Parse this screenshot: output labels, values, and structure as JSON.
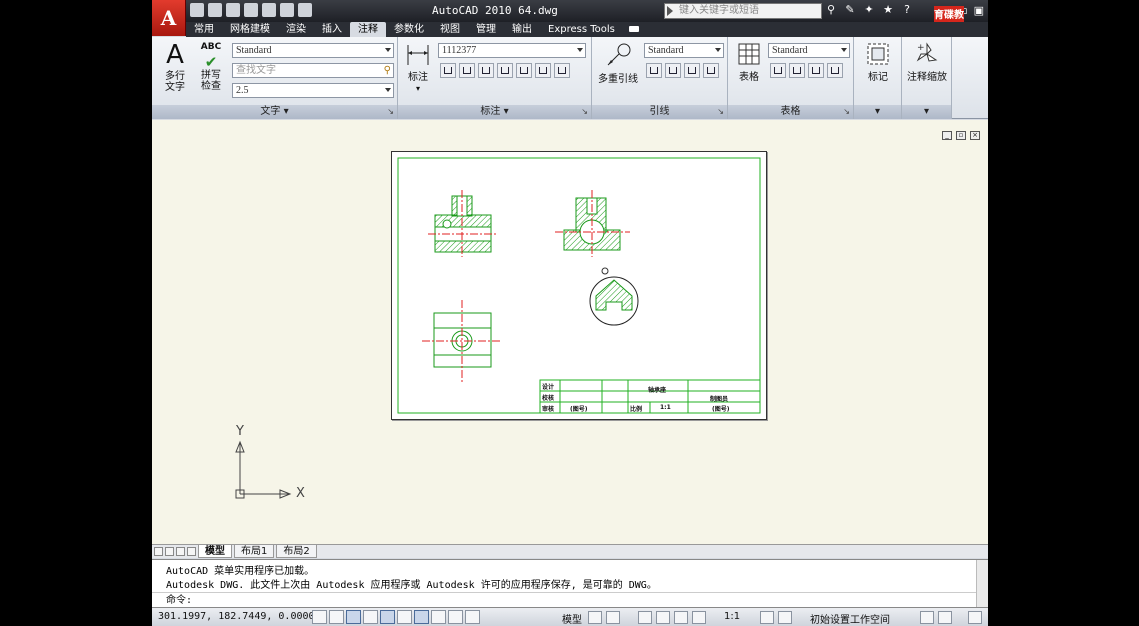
{
  "app": {
    "logo_letter": "A",
    "title": "AutoCAD 2010   64.dwg",
    "search_placeholder": "键入关键字或短语",
    "promo_text": "育碟教育"
  },
  "tabs": [
    "常用",
    "网格建模",
    "渲染",
    "插入",
    "注释",
    "参数化",
    "视图",
    "管理",
    "输出",
    "Express Tools"
  ],
  "active_tab": "注释",
  "ribbon": {
    "text_panel": {
      "multiline_label": "多行\n文字",
      "spell_label": "拼写\n检查",
      "spell_icon_text": "ABC",
      "style_combo": "Standard",
      "find_placeholder": "查找文字",
      "height_combo": "2.5",
      "title": "文字"
    },
    "dim_panel": {
      "dim_label": "标注",
      "style_combo": "1112377",
      "title": "标注"
    },
    "leader_panel": {
      "mleader_label": "多重引线",
      "style_combo": "Standard",
      "title": "引线"
    },
    "table_panel": {
      "table_label": "表格",
      "style_combo": "Standard",
      "title": "表格"
    },
    "markup_panel": {
      "label": "标记"
    },
    "scale_panel": {
      "label": "注释缩放"
    }
  },
  "title_block": {
    "designer": "设计",
    "checker": "校核",
    "reviewer": "审核",
    "part_name": "轴承座",
    "scale_label": "比例",
    "scale_value": "1:1",
    "school": "制图员",
    "class_no": "(图号)",
    "class_no2": "(图号)"
  },
  "ucs": {
    "x": "X",
    "y": "Y"
  },
  "layout_tabs": [
    "模型",
    "布局1",
    "布局2"
  ],
  "active_layout": "模型",
  "command": {
    "line1": "AutoCAD 菜单实用程序已加载。",
    "line2": "Autodesk DWG.   此文件上次由 Autodesk 应用程序或 Autodesk 许可的应用程序保存, 是可靠的 DWG。",
    "prompt": "命令:"
  },
  "status": {
    "coords": "301.1997, 182.7449, 0.0000",
    "model_label": "模型",
    "scale_text": "1:1",
    "workspace": "初始设置工作空间"
  }
}
